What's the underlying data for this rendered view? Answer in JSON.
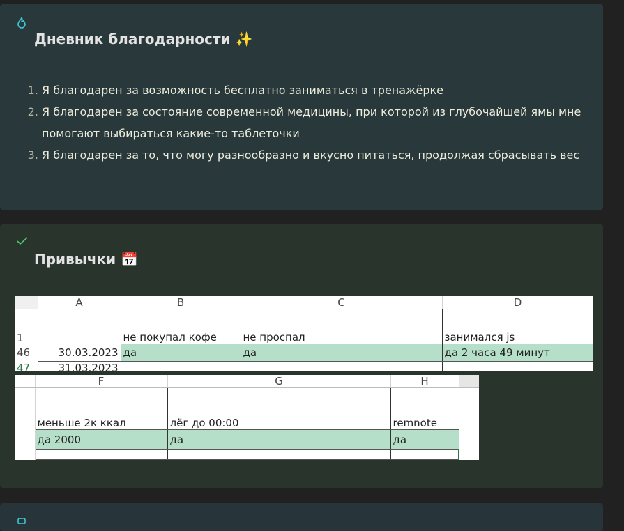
{
  "gratitude": {
    "title": "Дневник благодарности",
    "title_emoji": "✨",
    "icon": "flame-icon",
    "items": [
      "Я благодарен за возможность бесплатно заниматься в тренажёрке",
      "Я благодарен за состояние современной медицины, при которой из глубочайшей ямы мне помогают выбираться какие-то таблеточки",
      "Я благодарен за то, что могу разнообразно и вкусно питаться, продолжая сбрасывать вес"
    ]
  },
  "habits": {
    "title": "Привычки",
    "title_emoji": "📅",
    "icon": "check-icon",
    "sheet1": {
      "cols": [
        "A",
        "B",
        "C",
        "D"
      ],
      "header_row": "1",
      "headers": [
        "",
        "не покупал кофе",
        "не проспал",
        "занимался js"
      ],
      "row_num": "46",
      "row": [
        "30.03.2023",
        "да",
        "да",
        "да 2 часа 49 минут"
      ],
      "next_row_num": "47",
      "next_row_date": "31.03.2023"
    },
    "sheet2": {
      "cols": [
        "F",
        "G",
        "H"
      ],
      "headers": [
        "меньше 2к ккал",
        "лёг до 00:00",
        "remnote"
      ],
      "row": [
        "да 2000",
        "да",
        "да"
      ]
    }
  },
  "colors": {
    "green_cell": "#b5dfc9",
    "accent_cyan": "#3ec6d1",
    "accent_green": "#4cc96a"
  }
}
